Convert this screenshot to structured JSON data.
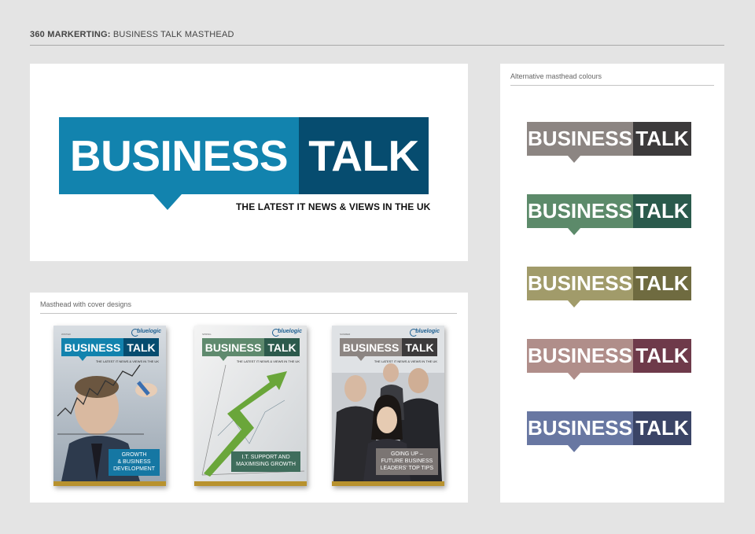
{
  "header": {
    "brand": "360 MARKERTING:",
    "title": "BUSINESS TALK MASTHEAD"
  },
  "main_masthead": {
    "word1": "BUSINESS",
    "word2": "TALK",
    "tagline": "THE LATEST IT NEWS & VIEWS IN THE UK",
    "colors": {
      "left": "#1283ae",
      "right": "#064c6f"
    }
  },
  "covers_panel": {
    "title": "Masthead with cover designs",
    "covers": [
      {
        "season": "WINTER",
        "logo": "bluelogic",
        "word1": "BUSINESS",
        "word2": "TALK",
        "tagline": "THE LATEST IT NEWS & VIEWS IN THE UK",
        "headline_line1": "GROWTH",
        "headline_line2": "& BUSINESS",
        "headline_line3": "DEVELOPMENT",
        "colors": {
          "left": "#1283ae",
          "right": "#064c6f",
          "headline": "#1577a3"
        }
      },
      {
        "season": "SPRING",
        "logo": "bluelogic",
        "word1": "BUSINESS",
        "word2": "TALK",
        "tagline": "THE LATEST IT NEWS & VIEWS IN THE UK",
        "headline_line1": "I.T. SUPPORT AND",
        "headline_line2": "MAXIMISING GROWTH",
        "headline_line3": "",
        "colors": {
          "left": "#5f8a6e",
          "right": "#2c5a4c",
          "headline": "#3f6d5c"
        }
      },
      {
        "season": "SUMMER",
        "logo": "bluelogic",
        "word1": "BUSINESS",
        "word2": "TALK",
        "tagline": "THE LATEST IT NEWS & VIEWS IN THE UK",
        "headline_line1": "GOING UP –",
        "headline_line2": "FUTURE BUSINESS",
        "headline_line3": "LEADERS' TOP TIPS",
        "colors": {
          "left": "#8c8582",
          "right": "#3c3a3b",
          "headline": "#7b7573"
        }
      }
    ]
  },
  "alt_panel": {
    "title": "Alternative masthead colours",
    "variants": [
      {
        "word1": "BUSINESS",
        "word2": "TALK",
        "colors": {
          "left": "#8c8582",
          "right": "#3c3a3b"
        }
      },
      {
        "word1": "BUSINESS",
        "word2": "TALK",
        "colors": {
          "left": "#5c8a6a",
          "right": "#2a5a4c"
        }
      },
      {
        "word1": "BUSINESS",
        "word2": "TALK",
        "colors": {
          "left": "#a19b6a",
          "right": "#6f6b40"
        }
      },
      {
        "word1": "BUSINESS",
        "word2": "TALK",
        "colors": {
          "left": "#b08e8a",
          "right": "#6e3a4a"
        }
      },
      {
        "word1": "BUSINESS",
        "word2": "TALK",
        "colors": {
          "left": "#6877a2",
          "right": "#3a4466"
        }
      }
    ]
  }
}
